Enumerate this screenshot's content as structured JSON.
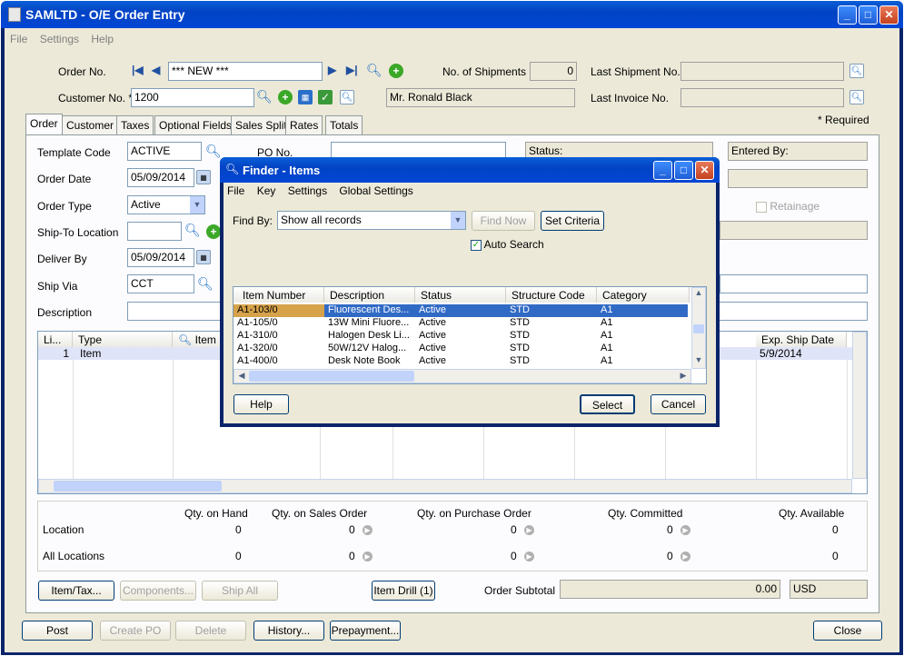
{
  "window": {
    "title": "SAMLTD - O/E Order Entry"
  },
  "menu": [
    "File",
    "Settings",
    "Help"
  ],
  "header": {
    "order_no_label": "Order No.",
    "order_no_value": "*** NEW ***",
    "customer_no_label": "Customer No. *",
    "customer_no_value": "1200",
    "customer_name": "Mr. Ronald Black",
    "shipments_label": "No. of Shipments",
    "shipments_value": "0",
    "last_shipment_label": "Last Shipment No.",
    "last_invoice_label": "Last Invoice No.",
    "required_note": "*  Required"
  },
  "tabs": [
    {
      "label": "Order"
    },
    {
      "label": "Customer"
    },
    {
      "label": "Taxes"
    },
    {
      "label": "Optional Fields"
    },
    {
      "label": "Sales Split"
    },
    {
      "label": "Rates"
    },
    {
      "label": "Totals"
    }
  ],
  "order": {
    "template_code_label": "Template Code",
    "template_code_value": "ACTIVE",
    "po_label": "PO No.",
    "status_label": "Status:",
    "entered_by_label": "Entered By:",
    "order_date_label": "Order Date",
    "order_date_value": "05/09/2014",
    "order_type_label": "Order Type",
    "order_type_value": "Active",
    "retainage_label": "Retainage",
    "ship_to_label": "Ship-To Location",
    "deliver_by_label": "Deliver By",
    "deliver_by_value": "05/09/2014",
    "ship_via_label": "Ship Via",
    "ship_via_value": "CCT",
    "description_label": "Description"
  },
  "lines": {
    "headers": [
      "Li...",
      "Type",
      "Item N",
      "Exp. Ship Date"
    ],
    "rows": [
      {
        "line": "1",
        "type": "Item",
        "exp_ship_date": "5/9/2014"
      }
    ]
  },
  "qty": {
    "headers": [
      "Qty. on Hand",
      "Qty. on Sales Order",
      "Qty. on Purchase Order",
      "Qty. Committed",
      "Qty. Available"
    ],
    "rows": [
      {
        "label": "Location",
        "values": [
          "0",
          "0",
          "0",
          "0",
          "0"
        ]
      },
      {
        "label": "All Locations",
        "values": [
          "0",
          "0",
          "0",
          "0",
          "0"
        ]
      }
    ]
  },
  "panel_buttons": {
    "item_tax": "Item/Tax...",
    "components": "Components...",
    "ship_all": "Ship All",
    "item_drill": "Item Drill (1)",
    "order_subtotal_label": "Order Subtotal",
    "order_subtotal_value": "0.00",
    "currency": "USD"
  },
  "footer": {
    "post": "Post",
    "create_po": "Create PO",
    "delete": "Delete",
    "history": "History...",
    "prepayment": "Prepayment...",
    "close": "Close"
  },
  "finder": {
    "title": "Finder - Items",
    "menu": [
      "File",
      "Key",
      "Settings",
      "Global Settings"
    ],
    "find_by_label": "Find By:",
    "find_by_value": "Show all records",
    "find_now": "Find Now",
    "set_criteria": "Set Criteria",
    "auto_search": "Auto Search",
    "columns": [
      "Item Number",
      "Description",
      "Status",
      "Structure Code",
      "Category"
    ],
    "rows": [
      {
        "item": "A1-103/0",
        "desc": "Fluorescent Des...",
        "status": "Active",
        "structure": "STD",
        "category": "A1"
      },
      {
        "item": "A1-105/0",
        "desc": "13W Mini Fluore...",
        "status": "Active",
        "structure": "STD",
        "category": "A1"
      },
      {
        "item": "A1-310/0",
        "desc": "Halogen Desk Li...",
        "status": "Active",
        "structure": "STD",
        "category": "A1"
      },
      {
        "item": "A1-320/0",
        "desc": "50W/12V Halog...",
        "status": "Active",
        "structure": "STD",
        "category": "A1"
      },
      {
        "item": "A1-400/0",
        "desc": "Desk Note Book",
        "status": "Active",
        "structure": "STD",
        "category": "A1"
      }
    ],
    "help": "Help",
    "select": "Select",
    "cancel": "Cancel"
  }
}
